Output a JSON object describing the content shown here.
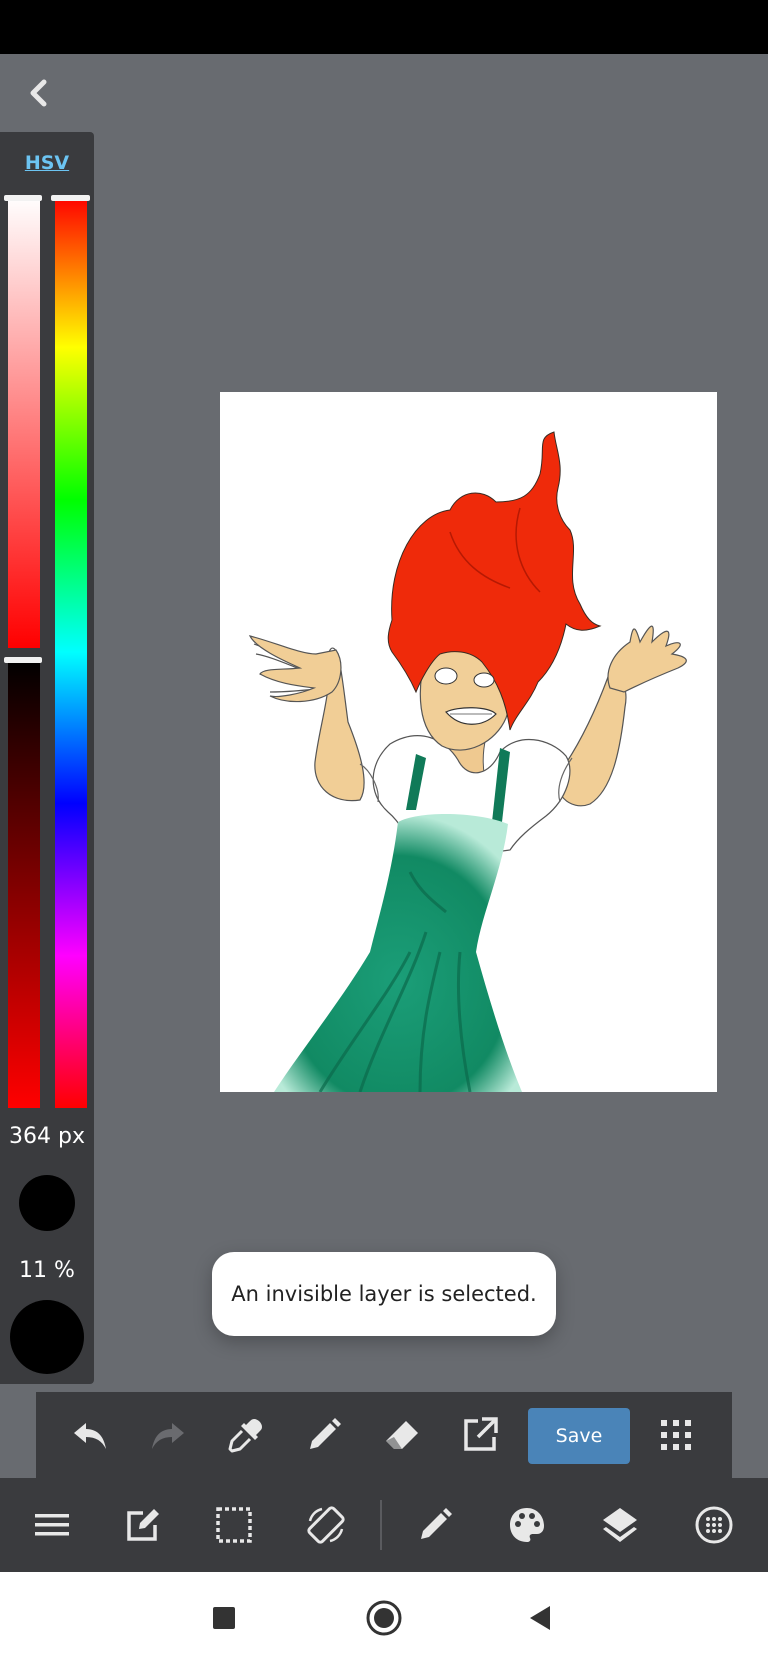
{
  "color_panel": {
    "mode_label": "HSV",
    "brush_size": "364 px",
    "brush_opacity": "11 %",
    "saturation_level": 1.0,
    "value_level": 1.0,
    "hue_level": 0.0
  },
  "toast": {
    "message": "An invisible layer is selected."
  },
  "toolbar": {
    "save_label": "Save"
  },
  "colors": {
    "accent": "#4a84b8",
    "hsv_label": "#6cc4f2",
    "panel": "#3a3b3e",
    "workspace": "#686b70"
  },
  "icons": {
    "back": "chevron-left-icon",
    "undo": "undo-icon",
    "redo": "redo-icon",
    "eyedropper": "eyedropper-icon",
    "pen": "pen-icon",
    "eraser": "eraser-icon",
    "export": "export-icon",
    "grid": "grid-icon",
    "menu": "menu-icon",
    "edit": "edit-icon",
    "selection": "selection-icon",
    "transform": "transform-icon",
    "brush": "brush-icon",
    "palette": "palette-icon",
    "layers": "layers-icon",
    "material": "material-icon",
    "stop": "recent-apps-icon",
    "home": "home-icon",
    "nav_back": "nav-back-icon"
  }
}
